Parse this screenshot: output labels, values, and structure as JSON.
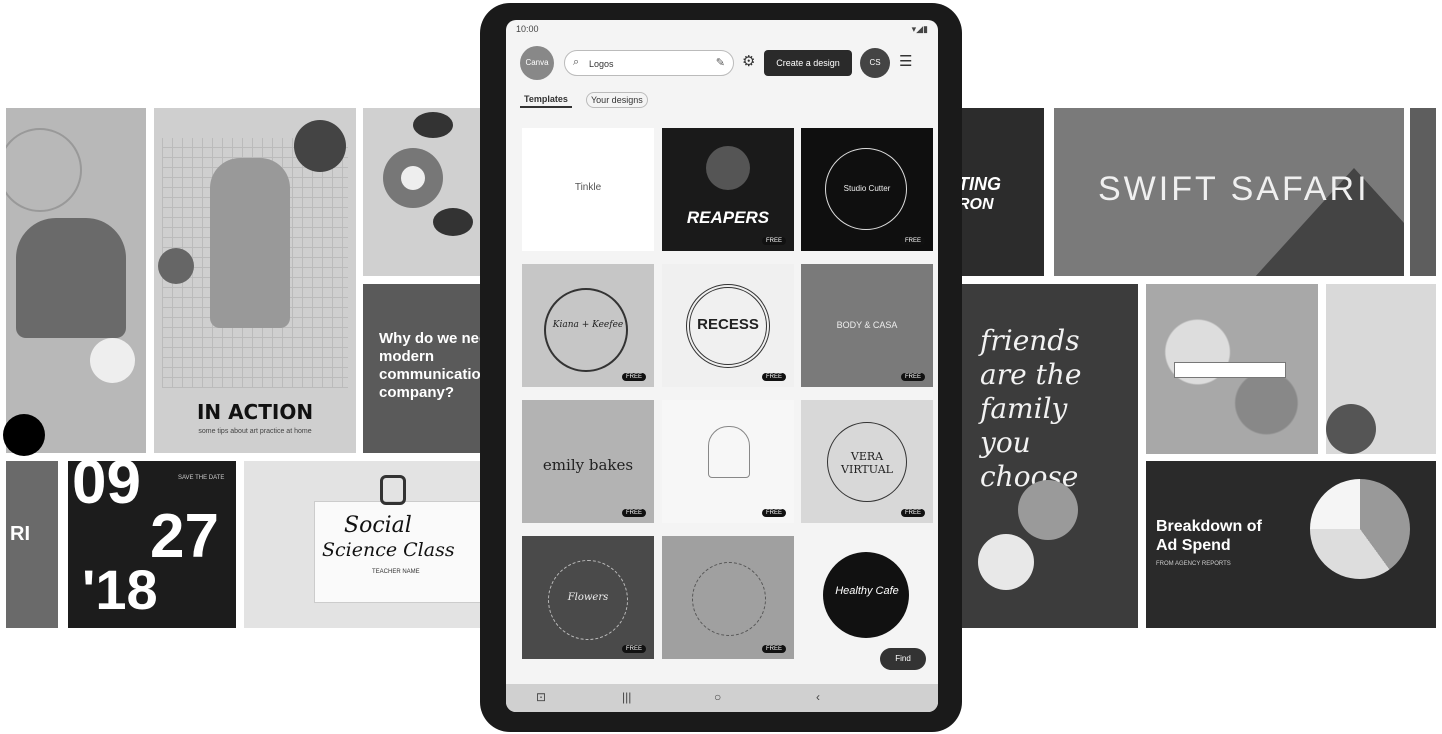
{
  "background_cards": {
    "in_action": "IN ACTION",
    "in_action_sub": "some tips about art practice at home",
    "question": "Why do we need a modern communication company?",
    "num_09": "09",
    "num_27": "27",
    "num_18": "'18",
    "save_date": "SAVE THE DATE",
    "ri": "RI",
    "social": "Social",
    "science_class": "Science Class",
    "teacher": "TEACHER NAME",
    "swift_safari": "SWIFT SAFARI",
    "acting": "TING",
    "acting2": "RON",
    "friends_quote": "friends are the family you choose",
    "breakdown": "Breakdown of Ad Spend",
    "breakdown_sub": "FROM AGENCY REPORTS"
  },
  "tablet": {
    "status_time": "10:00",
    "status_icons": "▾◢▮",
    "avatar_left": "Canva",
    "search_value": "Logos",
    "create_button": "Create a design",
    "avatar_right": "CS",
    "tabs": [
      "Templates",
      "Your designs"
    ],
    "tiles": [
      {
        "title": "Tinkle",
        "badge": ""
      },
      {
        "title": "REAPERS",
        "badge": "FREE"
      },
      {
        "title": "Studio Cutter",
        "badge": "FREE"
      },
      {
        "title": "Kiana + Keefee",
        "badge": "FREE"
      },
      {
        "title": "RECESS",
        "badge": "FREE"
      },
      {
        "title": "BODY & CASA",
        "badge": "FREE"
      },
      {
        "title": "emily bakes",
        "badge": "FREE"
      },
      {
        "title": "",
        "badge": "FREE"
      },
      {
        "title": "VERA VIRTUAL",
        "badge": "FREE"
      },
      {
        "title": "Flowers",
        "badge": "FREE"
      },
      {
        "title": "",
        "badge": "FREE"
      },
      {
        "title": "Healthy Cafe",
        "badge": ""
      }
    ],
    "fab": "Find",
    "nav": [
      "⊡",
      "|||",
      "○",
      "‹"
    ]
  }
}
